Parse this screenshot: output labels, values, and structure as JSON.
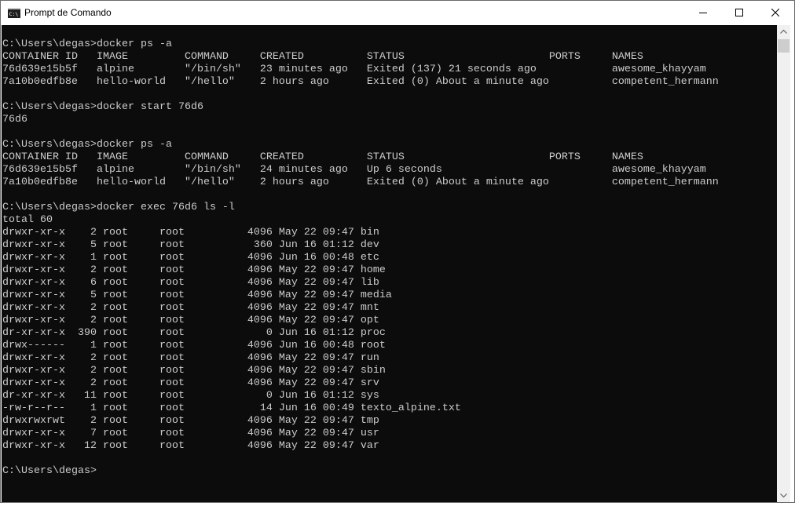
{
  "window": {
    "title": "Prompt de Comando",
    "icon": "cmd-icon",
    "controls": [
      "minimize-icon",
      "maximize-icon",
      "close-icon"
    ]
  },
  "console": {
    "lines": [
      "",
      "C:\\Users\\degas>docker ps -a",
      "CONTAINER ID   IMAGE         COMMAND     CREATED          STATUS                       PORTS     NAMES",
      "76d639e15b5f   alpine        \"/bin/sh\"   23 minutes ago   Exited (137) 21 seconds ago            awesome_khayyam",
      "7a10b0edfb8e   hello-world   \"/hello\"    2 hours ago      Exited (0) About a minute ago          competent_hermann",
      "",
      "C:\\Users\\degas>docker start 76d6",
      "76d6",
      "",
      "C:\\Users\\degas>docker ps -a",
      "CONTAINER ID   IMAGE         COMMAND     CREATED          STATUS                       PORTS     NAMES",
      "76d639e15b5f   alpine        \"/bin/sh\"   24 minutes ago   Up 6 seconds                           awesome_khayyam",
      "7a10b0edfb8e   hello-world   \"/hello\"    2 hours ago      Exited (0) About a minute ago          competent_hermann",
      "",
      "C:\\Users\\degas>docker exec 76d6 ls -l",
      "total 60",
      "drwxr-xr-x    2 root     root          4096 May 22 09:47 bin",
      "drwxr-xr-x    5 root     root           360 Jun 16 01:12 dev",
      "drwxr-xr-x    1 root     root          4096 Jun 16 00:48 etc",
      "drwxr-xr-x    2 root     root          4096 May 22 09:47 home",
      "drwxr-xr-x    6 root     root          4096 May 22 09:47 lib",
      "drwxr-xr-x    5 root     root          4096 May 22 09:47 media",
      "drwxr-xr-x    2 root     root          4096 May 22 09:47 mnt",
      "drwxr-xr-x    2 root     root          4096 May 22 09:47 opt",
      "dr-xr-xr-x  390 root     root             0 Jun 16 01:12 proc",
      "drwx------    1 root     root          4096 Jun 16 00:48 root",
      "drwxr-xr-x    2 root     root          4096 May 22 09:47 run",
      "drwxr-xr-x    2 root     root          4096 May 22 09:47 sbin",
      "drwxr-xr-x    2 root     root          4096 May 22 09:47 srv",
      "dr-xr-xr-x   11 root     root             0 Jun 16 01:12 sys",
      "-rw-r--r--    1 root     root            14 Jun 16 00:49 texto_alpine.txt",
      "drwxrwxrwt    2 root     root          4096 May 22 09:47 tmp",
      "drwxr-xr-x    7 root     root          4096 May 22 09:47 usr",
      "drwxr-xr-x   12 root     root          4096 May 22 09:47 var",
      "",
      "C:\\Users\\degas>"
    ]
  },
  "scrollbar": {
    "icons": [
      "scroll-up-arrow-icon",
      "scroll-down-arrow-icon"
    ]
  },
  "colors": {
    "console_bg": "#0c0c0c",
    "console_text": "#cccccc",
    "titlebar_bg": "#ffffff",
    "scrollbar_bg": "#f0f0f0"
  }
}
